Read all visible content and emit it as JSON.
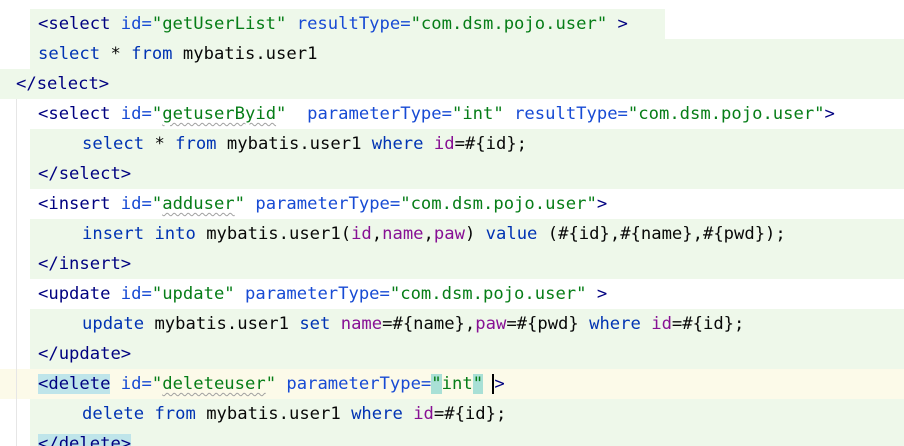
{
  "colors": {
    "tag": "#000080",
    "attribute": "#174ad4",
    "string": "#067d17",
    "sql_keyword": "#0033b3",
    "column": "#871094",
    "line_background": "#eef8ea",
    "caret_line": "#fcfae9"
  },
  "code": {
    "l1": {
      "open": "<",
      "tag": "select",
      "a1": " id=",
      "v1": "\"getUserList\"",
      "a2": " resultType=",
      "v2": "\"com.dsm.pojo.user\"",
      "close": " >"
    },
    "l2": {
      "kw1": "select",
      "t1": " * ",
      "kw2": "from",
      "t2": " mybatis.user1"
    },
    "l3": {
      "open": "</",
      "tag": "select",
      "close": ">"
    },
    "l4": {
      "open": "<",
      "tag": "select",
      "a1": " id=",
      "q1": "\"",
      "v1": "getuserByid",
      "q2": "\"",
      "a2": "  parameterType=",
      "v2": "\"int\"",
      "a3": " resultType=",
      "v3": "\"com.dsm.pojo.user\"",
      "close": ">"
    },
    "l5": {
      "kw1": "select",
      "t1": " * ",
      "kw2": "from",
      "t2": " mybatis.user1 ",
      "kw3": "where",
      "sp": " ",
      "c1": "id",
      "t3": "=#{id};"
    },
    "l6": {
      "open": "</",
      "tag": "select",
      "close": ">"
    },
    "l7": {
      "open": "<",
      "tag": "insert",
      "a1": " id=",
      "q1": "\"",
      "v1": "adduser",
      "q2": "\"",
      "a2": " parameterType=",
      "v2": "\"com.dsm.pojo.user\"",
      "close": ">"
    },
    "l8": {
      "kw1": "insert",
      "sp1": " ",
      "kw2": "into",
      "t1": " mybatis.user1(",
      "c1": "id",
      "cm1": ",",
      "c2": "name",
      "cm2": ",",
      "c3": "paw",
      "t2": ") ",
      "kw3": "value",
      "t3": " (#{id},#{name},#{pwd});"
    },
    "l9": {
      "open": "</",
      "tag": "insert",
      "close": ">"
    },
    "l10": {
      "open": "<",
      "tag": "update",
      "a1": " id=",
      "v1": "\"update\"",
      "a2": " parameterType=",
      "v2": "\"com.dsm.pojo.user\"",
      "close": " >"
    },
    "l11": {
      "kw1": "update",
      "t1": " mybatis.user1 ",
      "kw2": "set",
      "sp1": " ",
      "c1": "name",
      "t2": "=#{name},",
      "c2": "paw",
      "t3": "=#{pwd} ",
      "kw3": "where",
      "sp2": " ",
      "c3": "id",
      "t4": "=#{id};"
    },
    "l12": {
      "open": "</",
      "tag": "update",
      "close": ">"
    },
    "l13": {
      "open": "<",
      "tag": "delete",
      "a1": " id=",
      "q1": "\"",
      "v1": "deleteuser",
      "q2": "\"",
      "a2": " parameterType=",
      "q3": "\"",
      "v2": "int",
      "q4": "\"",
      "close_pre": " ",
      "close": ">"
    },
    "l14": {
      "kw1": "delete",
      "sp1": " ",
      "kw2": "from",
      "t1": " mybatis.user1 ",
      "kw3": "where",
      "sp2": " ",
      "c1": "id",
      "t2": "=#{id};"
    },
    "l15": {
      "open": "</",
      "tag": "delete",
      "close": ">"
    }
  }
}
